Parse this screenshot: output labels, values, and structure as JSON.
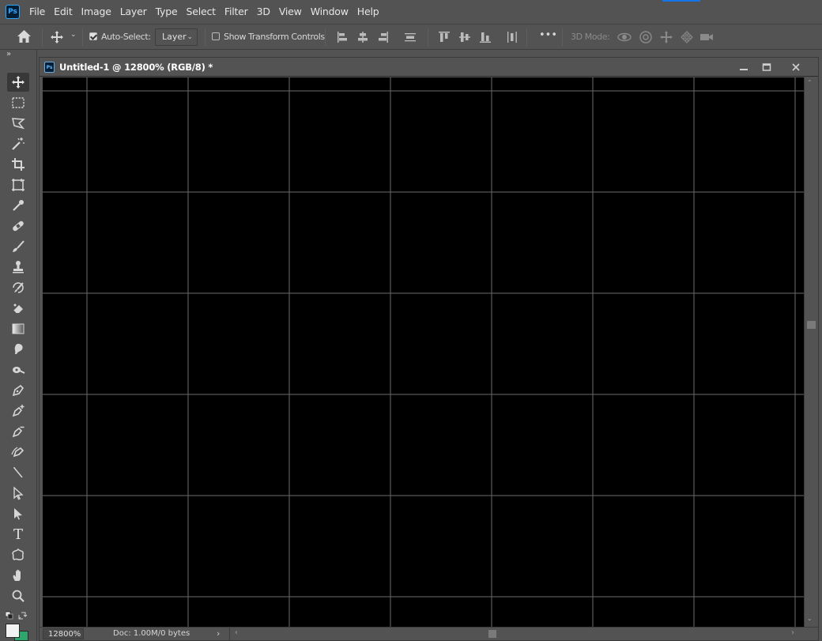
{
  "app": {
    "logo_text": "Ps",
    "menu": [
      "File",
      "Edit",
      "Image",
      "Layer",
      "Type",
      "Select",
      "Filter",
      "3D",
      "View",
      "Window",
      "Help"
    ]
  },
  "options_bar": {
    "auto_select_label": "Auto-Select:",
    "auto_select_checked": true,
    "auto_select_target": "Layer",
    "show_transform_label": "Show Transform Controls",
    "show_transform_checked": false,
    "three_d_mode_label": "3D Mode:",
    "more_label": "•••"
  },
  "toolbar": {
    "collapse_glyph": "»",
    "tools": [
      {
        "name": "move-tool",
        "icon": "move-icon",
        "active": true
      },
      {
        "name": "rectangular-marquee-tool",
        "icon": "marquee-icon"
      },
      {
        "name": "polygonal-lasso-tool",
        "icon": "lasso-icon"
      },
      {
        "name": "magic-wand-tool",
        "icon": "magic-wand-icon"
      },
      {
        "name": "crop-tool",
        "icon": "crop-icon"
      },
      {
        "name": "frame-tool",
        "icon": "frame-icon"
      },
      {
        "name": "eyedropper-tool",
        "icon": "eyedropper-icon"
      },
      {
        "name": "healing-brush-tool",
        "icon": "bandage-icon"
      },
      {
        "name": "brush-tool",
        "icon": "brush-icon"
      },
      {
        "name": "clone-stamp-tool",
        "icon": "stamp-icon"
      },
      {
        "name": "history-brush-tool",
        "icon": "history-brush-icon"
      },
      {
        "name": "eraser-tool",
        "icon": "eraser-icon"
      },
      {
        "name": "gradient-tool",
        "icon": "gradient-icon"
      },
      {
        "name": "blur-tool",
        "icon": "blur-icon"
      },
      {
        "name": "dodge-tool",
        "icon": "dodge-icon"
      },
      {
        "name": "pen-tool",
        "icon": "pen-icon"
      },
      {
        "name": "add-anchor-point-tool",
        "icon": "pen-plus-icon"
      },
      {
        "name": "delete-anchor-point-tool",
        "icon": "pen-minus-icon"
      },
      {
        "name": "curvature-pen-tool",
        "icon": "curvature-pen-icon"
      },
      {
        "name": "convert-point-tool",
        "icon": "convert-point-icon"
      },
      {
        "name": "direct-selection-tool",
        "icon": "direct-select-icon"
      },
      {
        "name": "path-selection-tool",
        "icon": "path-select-icon"
      },
      {
        "name": "type-tool",
        "icon": "type-icon",
        "glyph": "T"
      },
      {
        "name": "custom-shape-tool",
        "icon": "custom-shape-icon"
      },
      {
        "name": "hand-tool",
        "icon": "hand-icon"
      },
      {
        "name": "zoom-tool",
        "icon": "zoom-icon"
      }
    ],
    "foreground_color": "#f2f2f2",
    "background_color": "#2ca66a"
  },
  "document": {
    "title": "Untitled-1 @ 12800% (RGB/8) *",
    "icon_text": "Ps",
    "canvas_color": "#000000",
    "pixel_grid_color": "#6b6b6b"
  },
  "status": {
    "zoom": "12800%",
    "doc_info": "Doc: 1.00M/0 bytes"
  }
}
